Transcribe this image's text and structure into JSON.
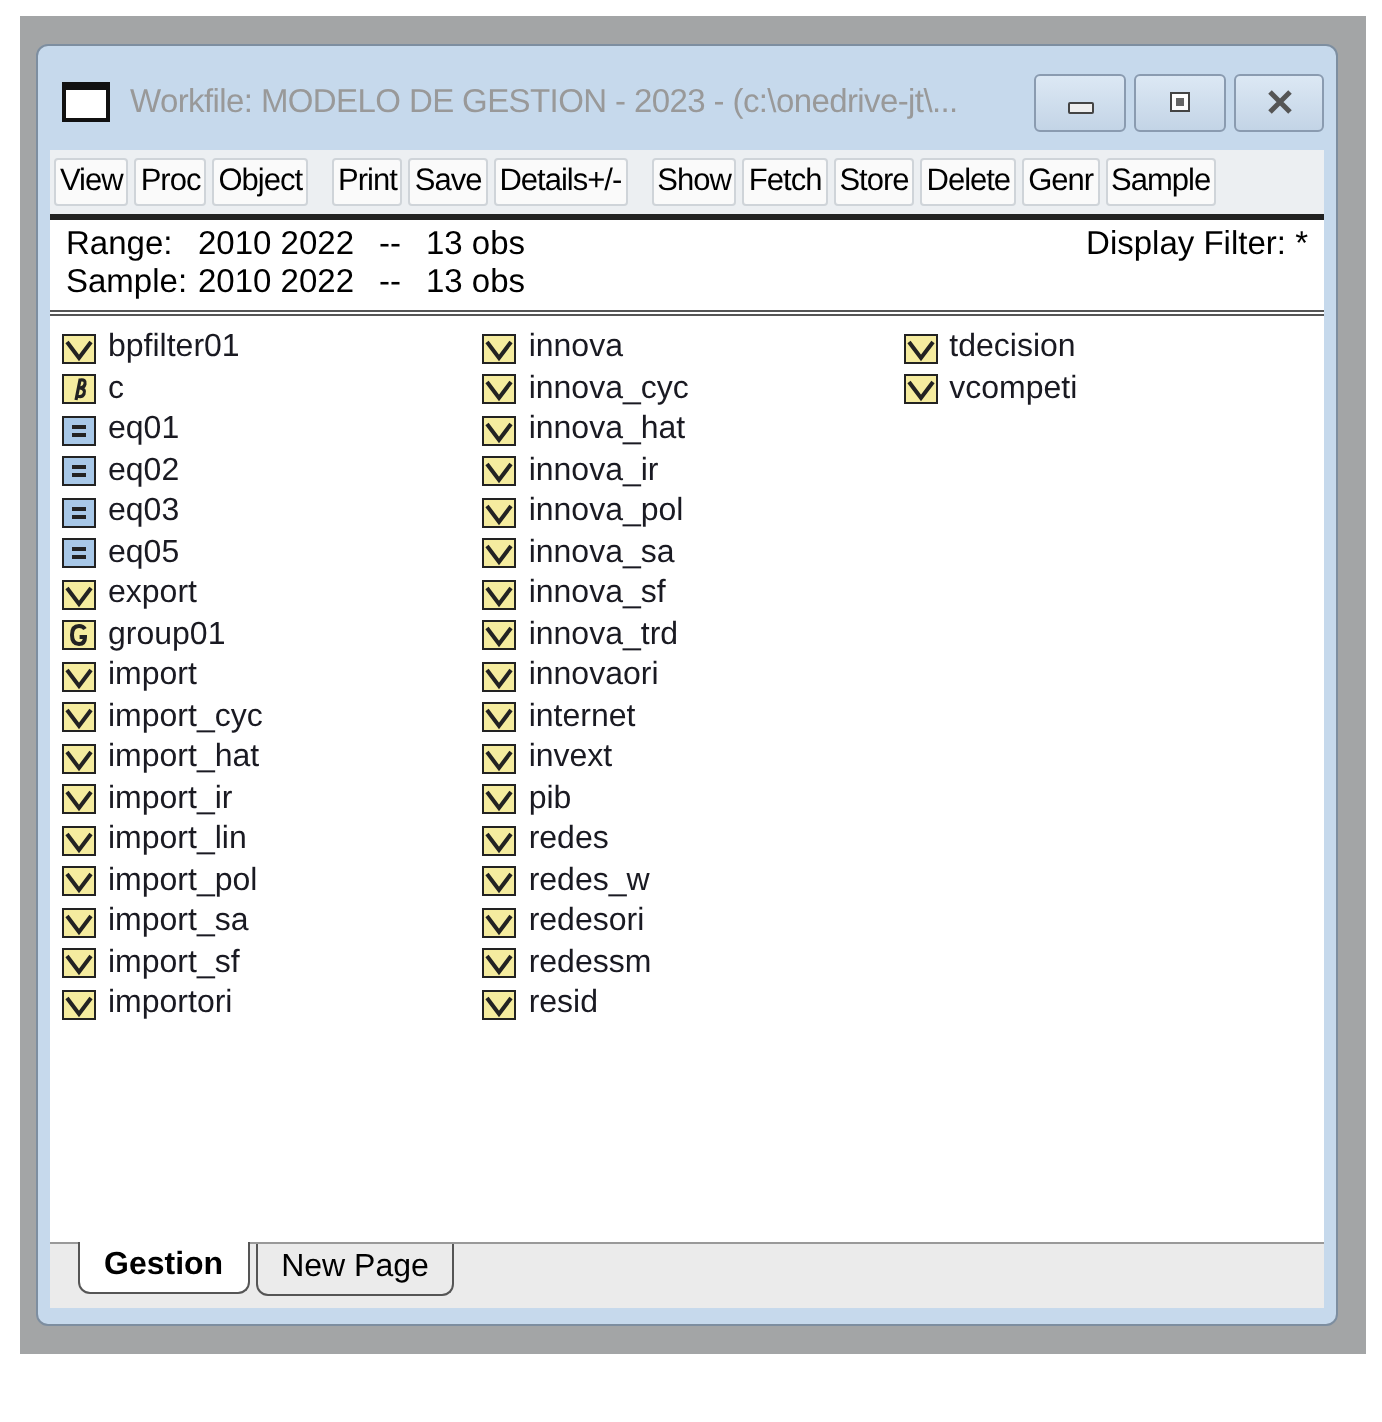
{
  "window": {
    "title": "Workfile: MODELO DE GESTION - 2023 - (c:\\onedrive-jt\\..."
  },
  "toolbar": [
    "View",
    "Proc",
    "Object",
    "Print",
    "Save",
    "Details+/-",
    "Show",
    "Fetch",
    "Store",
    "Delete",
    "Genr",
    "Sample"
  ],
  "info": {
    "range_label": "Range:",
    "range": "2010 2022",
    "range_sep": "--",
    "range_obs": "13 obs",
    "sample_label": "Sample:",
    "sample": "2010 2022",
    "sample_sep": "--",
    "sample_obs": "13 obs",
    "filter": "Display Filter: *"
  },
  "objects": [
    {
      "name": "bpfilter01",
      "kind": "series"
    },
    {
      "name": "c",
      "kind": "coef"
    },
    {
      "name": "eq01",
      "kind": "equation"
    },
    {
      "name": "eq02",
      "kind": "equation"
    },
    {
      "name": "eq03",
      "kind": "equation"
    },
    {
      "name": "eq05",
      "kind": "equation"
    },
    {
      "name": "export",
      "kind": "series"
    },
    {
      "name": "group01",
      "kind": "group"
    },
    {
      "name": "import",
      "kind": "series"
    },
    {
      "name": "import_cyc",
      "kind": "series"
    },
    {
      "name": "import_hat",
      "kind": "series"
    },
    {
      "name": "import_ir",
      "kind": "series"
    },
    {
      "name": "import_lin",
      "kind": "series"
    },
    {
      "name": "import_pol",
      "kind": "series"
    },
    {
      "name": "import_sa",
      "kind": "series"
    },
    {
      "name": "import_sf",
      "kind": "series"
    },
    {
      "name": "importori",
      "kind": "series"
    },
    {
      "name": "innova",
      "kind": "series"
    },
    {
      "name": "innova_cyc",
      "kind": "series"
    },
    {
      "name": "innova_hat",
      "kind": "series"
    },
    {
      "name": "innova_ir",
      "kind": "series"
    },
    {
      "name": "innova_pol",
      "kind": "series"
    },
    {
      "name": "innova_sa",
      "kind": "series"
    },
    {
      "name": "innova_sf",
      "kind": "series"
    },
    {
      "name": "innova_trd",
      "kind": "series"
    },
    {
      "name": "innovaori",
      "kind": "series"
    },
    {
      "name": "internet",
      "kind": "series"
    },
    {
      "name": "invext",
      "kind": "series"
    },
    {
      "name": "pib",
      "kind": "series"
    },
    {
      "name": "redes",
      "kind": "series"
    },
    {
      "name": "redes_w",
      "kind": "series"
    },
    {
      "name": "redesori",
      "kind": "series"
    },
    {
      "name": "redessm",
      "kind": "series"
    },
    {
      "name": "resid",
      "kind": "series"
    },
    {
      "name": "tdecision",
      "kind": "series"
    },
    {
      "name": "vcompeti",
      "kind": "series"
    }
  ],
  "page_tabs": [
    {
      "label": "Gestion",
      "selected": true
    },
    {
      "label": "New Page",
      "selected": false
    }
  ]
}
